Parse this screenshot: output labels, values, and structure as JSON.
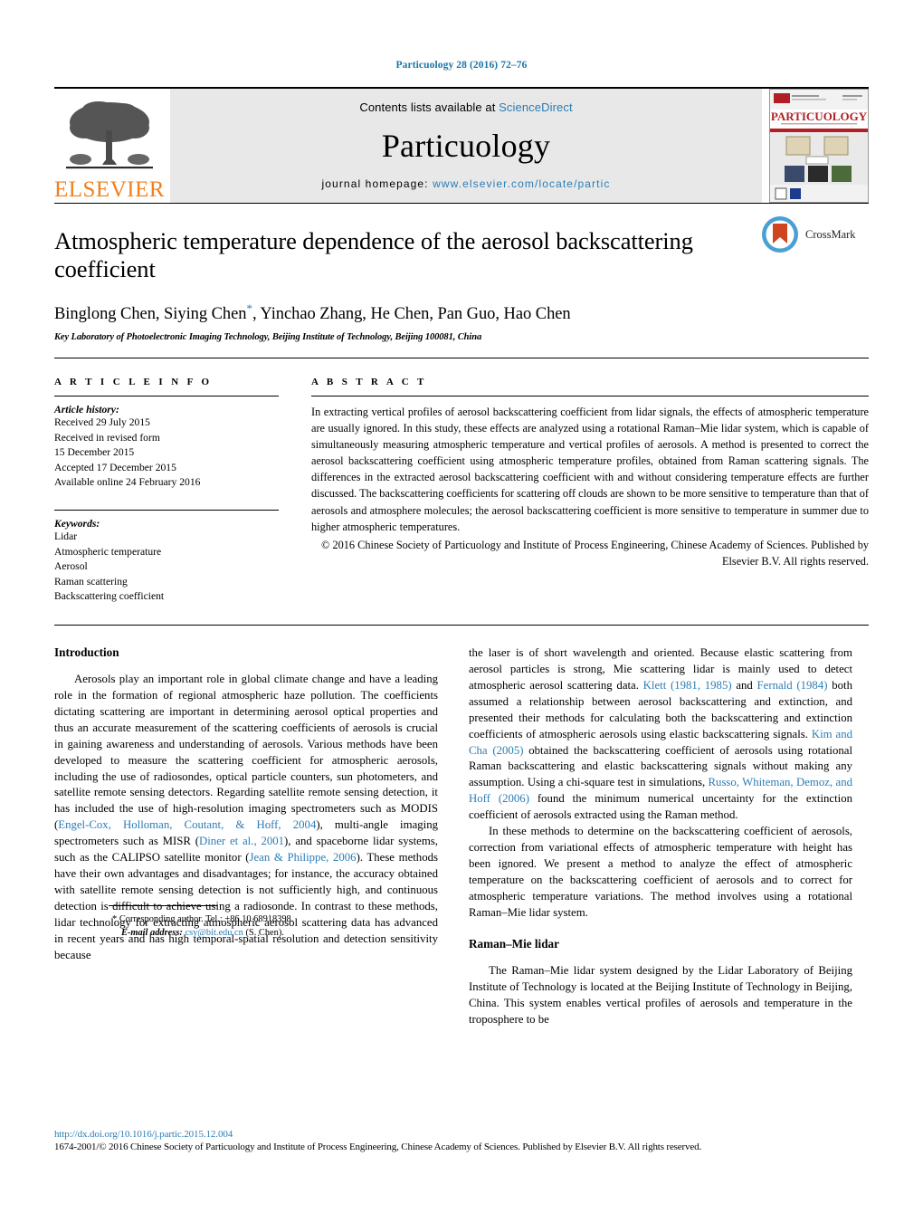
{
  "running_head": "Particuology 28 (2016) 72–76",
  "masthead": {
    "publisher_logo_name": "elsevier-tree-logo",
    "publisher_wordmark": "ELSEVIER",
    "contents_prefix": "Contents lists available at ",
    "contents_link": "ScienceDirect",
    "journal_name": "Particuology",
    "homepage_prefix": "journal homepage: ",
    "homepage_url": "www.elsevier.com/locate/partic",
    "cover_title": "PARTICUOLOGY"
  },
  "article": {
    "title": "Atmospheric temperature dependence of the aerosol backscattering coefficient",
    "authors": "Binglong Chen, Siying Chen",
    "authors_rest": ", Yinchao Zhang, He Chen, Pan Guo, Hao Chen",
    "corresponding_marker": "*",
    "affiliation": "Key Laboratory of Photoelectronic Imaging Technology, Beijing Institute of Technology, Beijing 100081, China",
    "crossmark_label": "CrossMark"
  },
  "article_info": {
    "heading": "A R T I C L E    I N F O",
    "history_label": "Article history:",
    "history": [
      "Received 29 July 2015",
      "Received in revised form",
      "15 December 2015",
      "Accepted 17 December 2015",
      "Available online 24 February 2016"
    ],
    "keywords_label": "Keywords:",
    "keywords": [
      "Lidar",
      "Atmospheric temperature",
      "Aerosol",
      "Raman scattering",
      "Backscattering coefficient"
    ]
  },
  "abstract": {
    "heading": "A B S T R A C T",
    "text": "In extracting vertical profiles of aerosol backscattering coefficient from lidar signals, the effects of atmospheric temperature are usually ignored. In this study, these effects are analyzed using a rotational Raman–Mie lidar system, which is capable of simultaneously measuring atmospheric temperature and vertical profiles of aerosols. A method is presented to correct the aerosol backscattering coefficient using atmospheric temperature profiles, obtained from Raman scattering signals. The differences in the extracted aerosol backscattering coefficient with and without considering temperature effects are further discussed. The backscattering coefficients for scattering off clouds are shown to be more sensitive to temperature than that of aerosols and atmosphere molecules; the aerosol backscattering coefficient is more sensitive to temperature in summer due to higher atmospheric temperatures.",
    "copyright": "© 2016 Chinese Society of Particuology and Institute of Process Engineering, Chinese Academy of Sciences. Published by Elsevier B.V. All rights reserved."
  },
  "body": {
    "introduction_heading": "Introduction",
    "intro_p1_a": "Aerosols play an important role in global climate change and have a leading role in the formation of regional atmospheric haze pollution. The coefficients dictating scattering are important in determining aerosol optical properties and thus an accurate measurement of the scattering coefficients of aerosols is crucial in gaining awareness and understanding of aerosols. Various methods have been developed to measure the scattering coefficient for atmospheric aerosols, including the use of radiosondes, optical particle counters, sun photometers, and satellite remote sensing detectors. Regarding satellite remote sensing detection, it has included the use of high-resolution imaging spectrometers such as MODIS (",
    "ref_engel": "Engel-Cox, Holloman, Coutant, & Hoff, 2004",
    "intro_p1_b": "), multi-angle imaging spectrometers such as MISR (",
    "ref_diner": "Diner et al., 2001",
    "intro_p1_c": "), and spaceborne lidar systems, such as the CALIPSO satellite monitor (",
    "ref_jean": "Jean & Philippe, 2006",
    "intro_p1_d": "). These methods have their own advantages and disadvantages; for instance, the accuracy obtained with satellite remote sensing detection is not sufficiently high, and continuous detection is difficult to achieve using a radiosonde. In contrast to these methods, lidar technology for extracting atmospheric aerosol scattering data has advanced in recent years and has high temporal-spatial resolution and detection sensitivity because",
    "intro_p2_a": "the laser is of short wavelength and oriented. Because elastic scattering from aerosol particles is strong, Mie scattering lidar is mainly used to detect atmospheric aerosol scattering data. ",
    "ref_klett": "Klett (1981, 1985)",
    "intro_p2_b": " and ",
    "ref_fernald": "Fernald (1984)",
    "intro_p2_c": " both assumed a relationship between aerosol backscattering and extinction, and presented their methods for calculating both the backscattering and extinction coefficients of atmospheric aerosols using elastic backscattering signals. ",
    "ref_kim": "Kim and Cha (2005)",
    "intro_p2_d": " obtained the backscattering coefficient of aerosols using rotational Raman backscattering and elastic backscattering signals without making any assumption. Using a chi-square test in simulations, ",
    "ref_russo": "Russo, Whiteman, Demoz, and Hoff (2006)",
    "intro_p2_e": " found the minimum numerical uncertainty for the extinction coefficient of aerosols extracted using the Raman method.",
    "intro_p3": "In these methods to determine on the backscattering coefficient of aerosols, correction from variational effects of atmospheric temperature with height has been ignored. We present a method to analyze the effect of atmospheric temperature on the backscattering coefficient of aerosols and to correct for atmospheric temperature variations. The method involves using a rotational Raman–Mie lidar system.",
    "raman_heading": "Raman–Mie lidar",
    "raman_p1": "The Raman–Mie lidar system designed by the Lidar Laboratory of Beijing Institute of Technology is located at the Beijing Institute of Technology in Beijing, China. This system enables vertical profiles of aerosols and temperature in the troposphere to be"
  },
  "footnote": {
    "marker": "*",
    "corresponding": "Corresponding author. Tel.: +86 10 68918398.",
    "email_label": "E-mail address:",
    "email": "csy@bit.edu.cn",
    "email_owner": "(S. Chen)."
  },
  "page_footer": {
    "doi": "http://dx.doi.org/10.1016/j.partic.2015.12.004",
    "copyright": "1674-2001/© 2016 Chinese Society of Particuology and Institute of Process Engineering, Chinese Academy of Sciences. Published by Elsevier B.V. All rights reserved."
  },
  "colors": {
    "link_blue": "#2b7db5",
    "elsevier_orange": "#f08020",
    "banner_gray": "#e8e8e8",
    "crossmark_red": "#cf4520",
    "crossmark_blue": "#4a9fd4"
  }
}
